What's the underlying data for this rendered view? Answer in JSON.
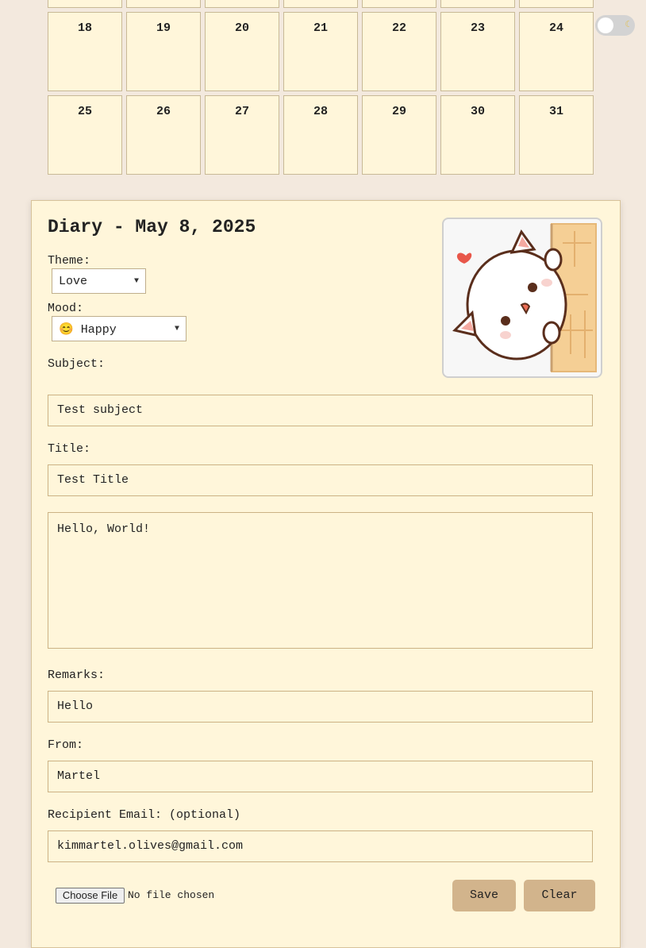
{
  "calendar": {
    "row_top": [
      "",
      "",
      "",
      "",
      "",
      "",
      ""
    ],
    "row_a": [
      "18",
      "19",
      "20",
      "21",
      "22",
      "23",
      "24"
    ],
    "row_b": [
      "25",
      "26",
      "27",
      "28",
      "29",
      "30",
      "31"
    ]
  },
  "theme_toggle": {
    "icon": "moon-icon"
  },
  "diary": {
    "title": "Diary - May 8, 2025",
    "theme_label": "Theme:",
    "theme_value": "Love",
    "mood_label": "Mood:",
    "mood_emoji": "😊",
    "mood_value": "Happy",
    "subject_label": "Subject:",
    "subject_value": "Test subject",
    "title_label": "Title:",
    "title_value": "Test Title",
    "body_value": "Hello, World!",
    "remarks_label": "Remarks:",
    "remarks_value": "Hello",
    "from_label": "From:",
    "from_value": "Martel",
    "email_label": "Recipient Email: (optional)",
    "email_value": "kimmartel.olives@gmail.com",
    "file_button": "Choose File",
    "file_status": "No file chosen",
    "save_label": "Save",
    "clear_label": "Clear"
  },
  "colors": {
    "background": "#f3e9de",
    "panel": "#fff6da",
    "button": "#d2b48c"
  }
}
